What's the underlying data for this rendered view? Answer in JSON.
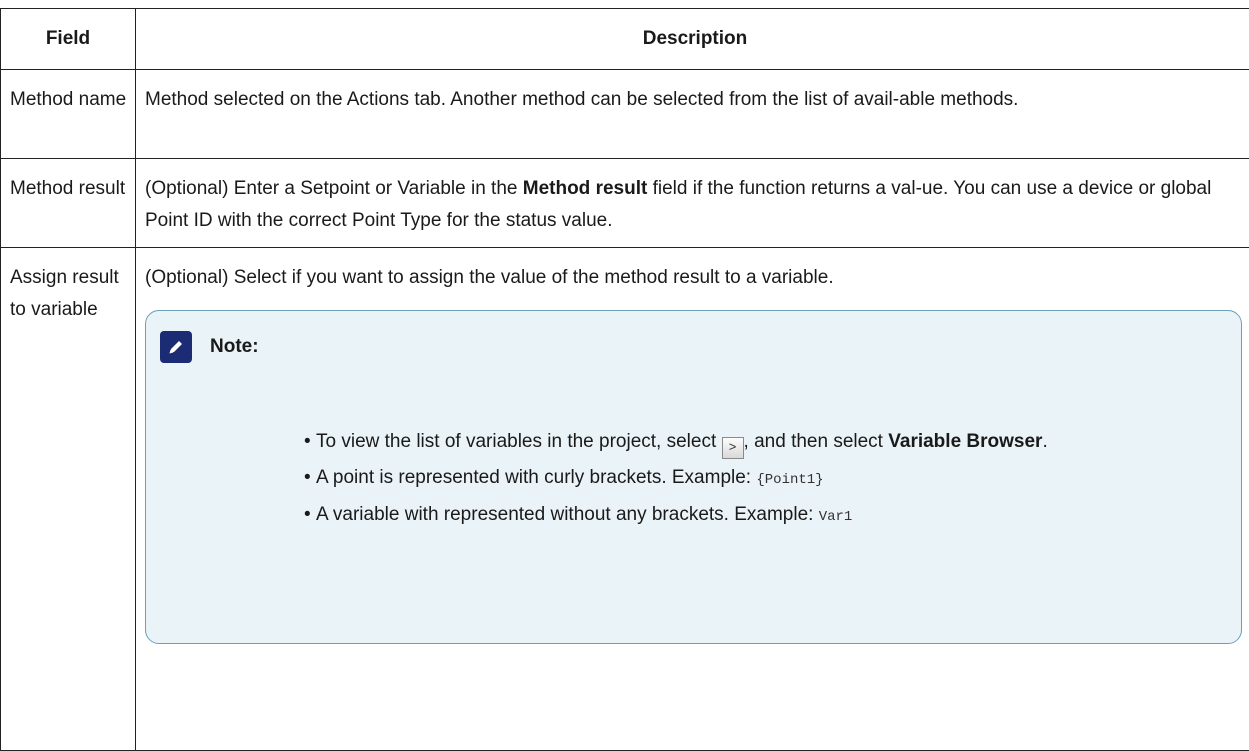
{
  "table": {
    "headers": [
      "Field",
      "Description"
    ],
    "rows": [
      {
        "field": "Method name",
        "description": "Method selected on the Actions tab. Another method can be selected from the list of avail-able methods."
      },
      {
        "field": "Method result",
        "description_pre": "(Optional) Enter a Setpoint or Variable in the ",
        "description_bold": "Method result",
        "description_post": " field if the function returns a val-ue. You can use a device or global Point ID with the correct Point Type for the status value."
      },
      {
        "field": "Assign result to variable",
        "description": "(Optional) Select if you want to assign the value of the method result to a variable."
      }
    ]
  },
  "note": {
    "title": "Note:",
    "icon": "pencil-icon",
    "items": [
      {
        "pre": "To view the list of variables in the project, select ",
        "button_glyph": ">",
        "mid": ", and then select ",
        "bold": "Variable Browser",
        "post": "."
      },
      {
        "pre": "A point is represented with curly brackets. Example: ",
        "code": "{Point1}"
      },
      {
        "pre": "A variable with represented without any brackets. Example: ",
        "code": "Var1"
      }
    ]
  },
  "colors": {
    "note_background": "#eaf3f7",
    "note_border": "#6e9fb8",
    "icon_background": "#1b2c74"
  }
}
